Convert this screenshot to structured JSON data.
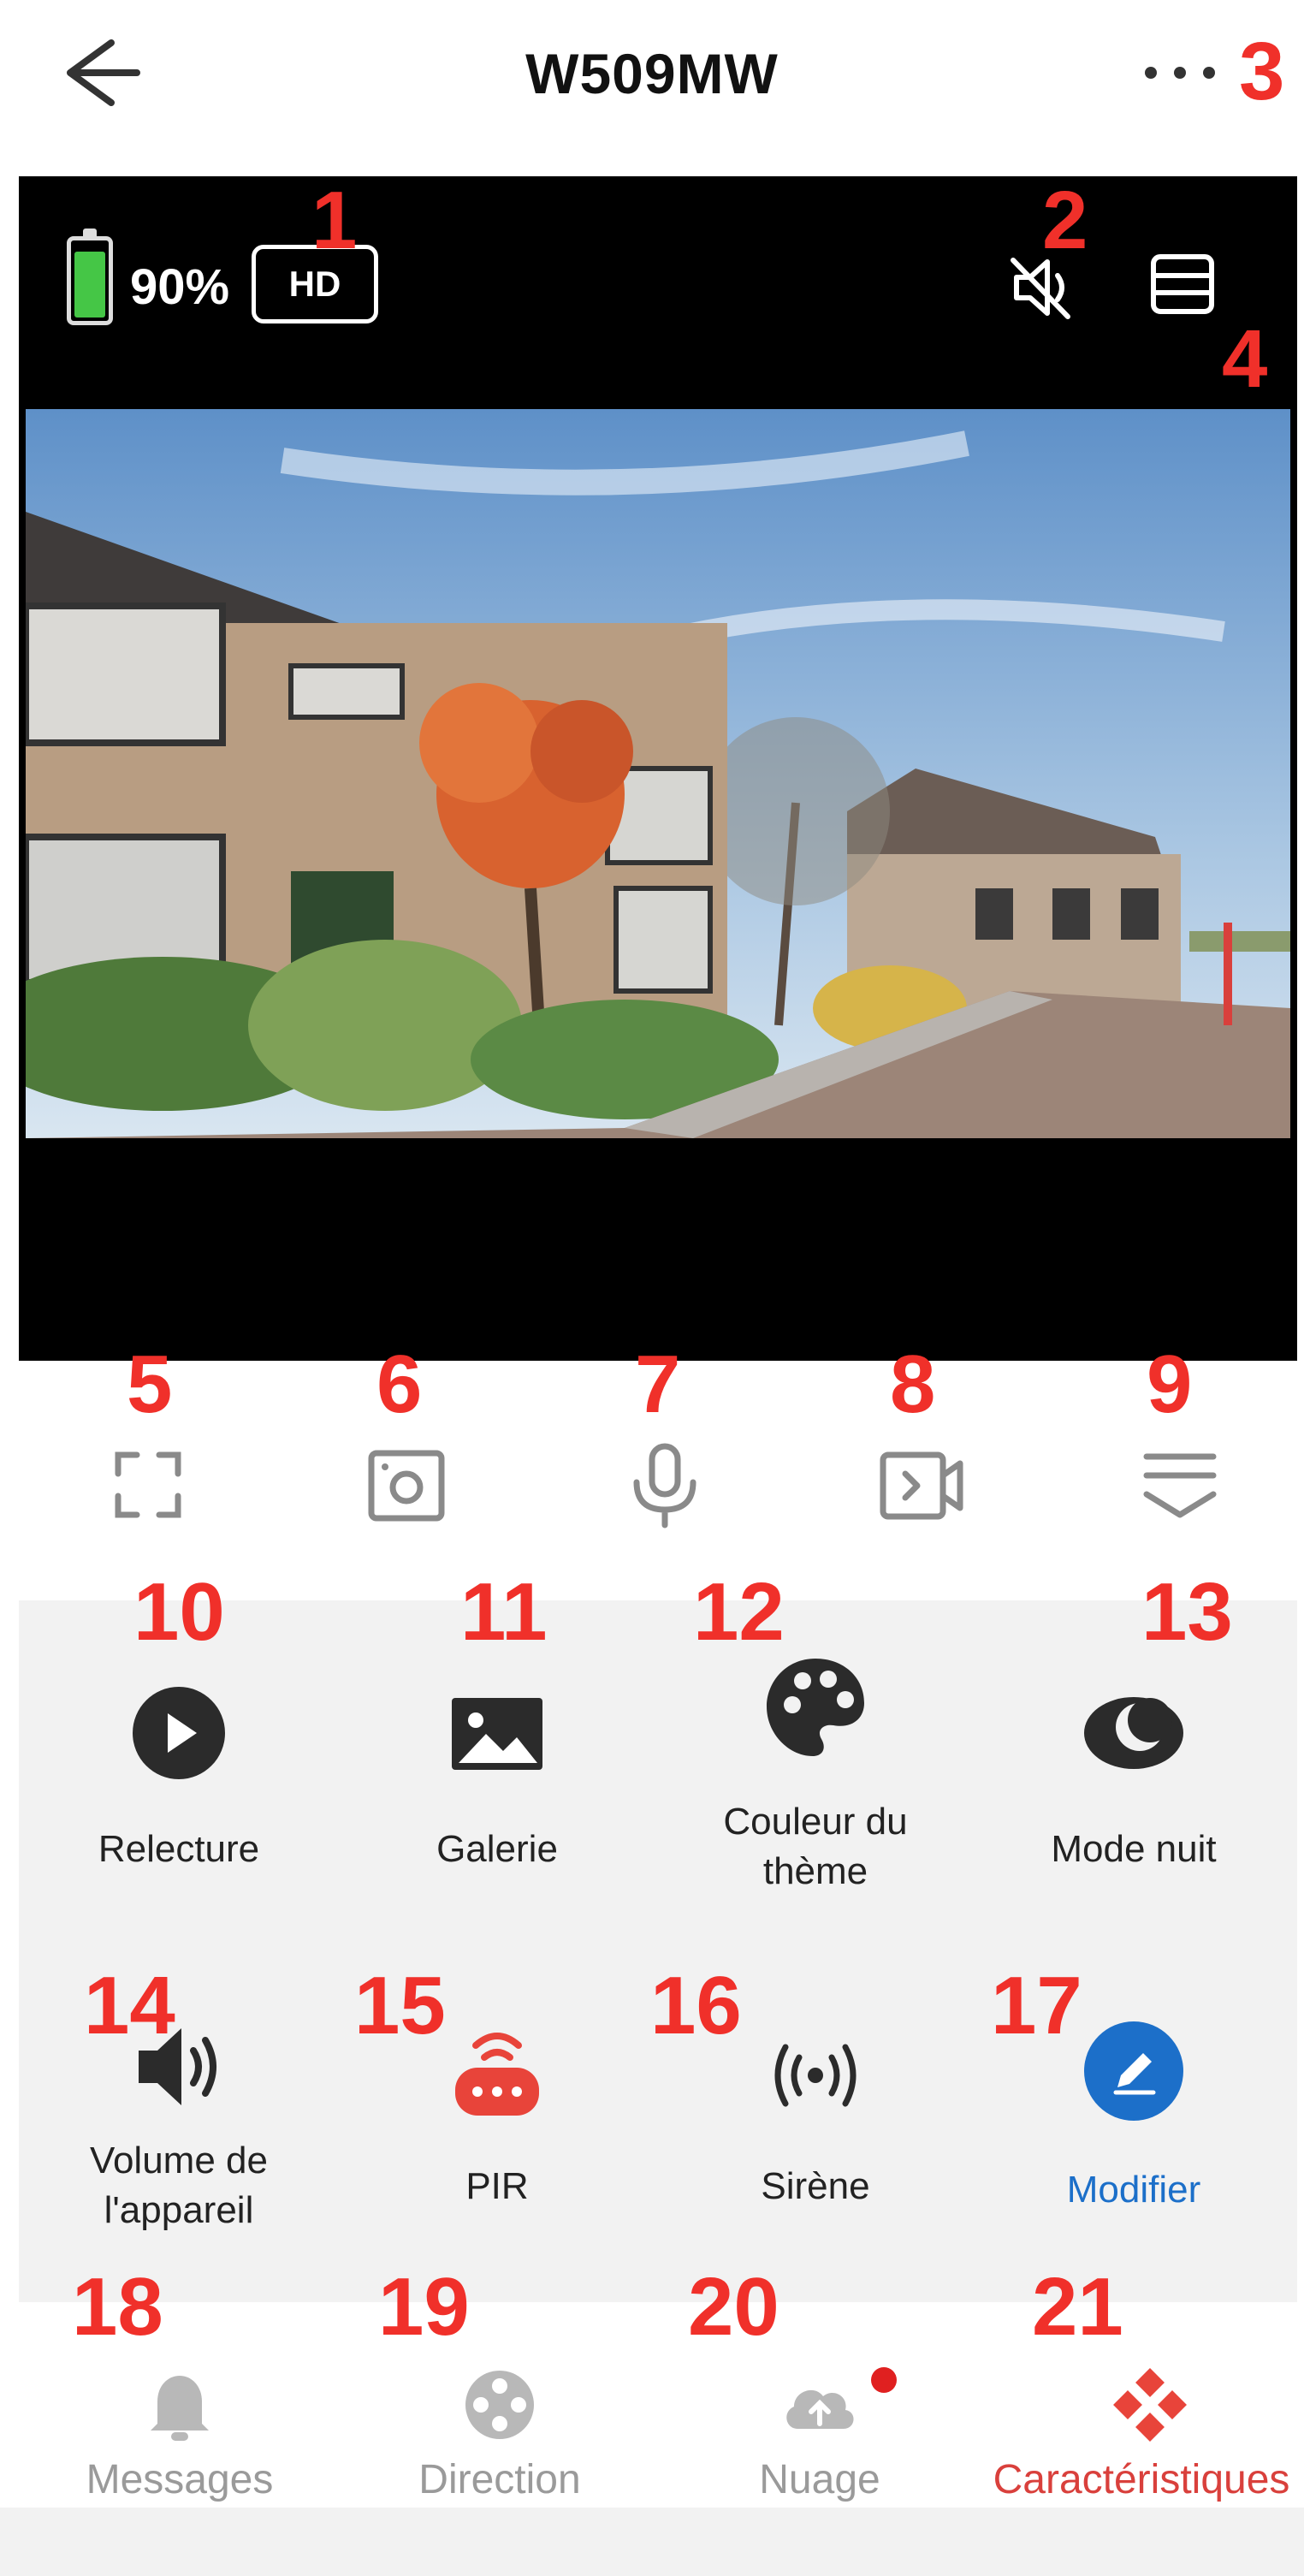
{
  "header": {
    "title": "W509MW"
  },
  "video": {
    "battery_pct": "90%",
    "battery_level": 0.9,
    "quality": "HD"
  },
  "features": [
    {
      "label": "Relecture",
      "icon": "play-circle-icon"
    },
    {
      "label": "Galerie",
      "icon": "image-icon"
    },
    {
      "label": "Couleur du\nthème",
      "icon": "palette-icon"
    },
    {
      "label": "Mode nuit",
      "icon": "moon-icon"
    },
    {
      "label": "Volume de\nl'appareil",
      "icon": "speaker-icon"
    },
    {
      "label": "PIR",
      "icon": "pir-sensor-icon"
    },
    {
      "label": "Sirène",
      "icon": "siren-icon"
    },
    {
      "label": "Modifier",
      "icon": "edit-icon"
    }
  ],
  "bottom_nav": [
    {
      "label": "Messages",
      "icon": "bell-icon",
      "active": false
    },
    {
      "label": "Direction",
      "icon": "direction-pad-icon",
      "active": false
    },
    {
      "label": "Nuage",
      "icon": "cloud-upload-icon",
      "active": false,
      "badge": true
    },
    {
      "label": "Caractéristiques",
      "icon": "features-icon",
      "active": true
    }
  ],
  "annotations": [
    "1",
    "2",
    "3",
    "4",
    "5",
    "6",
    "7",
    "8",
    "9",
    "10",
    "11",
    "12",
    "13",
    "14",
    "15",
    "16",
    "17",
    "18",
    "19",
    "20",
    "21"
  ],
  "colors": {
    "annotation": "#f0302a",
    "accent_red": "#d9403c",
    "link_blue": "#1c6fc9",
    "battery_green": "#45c646"
  }
}
